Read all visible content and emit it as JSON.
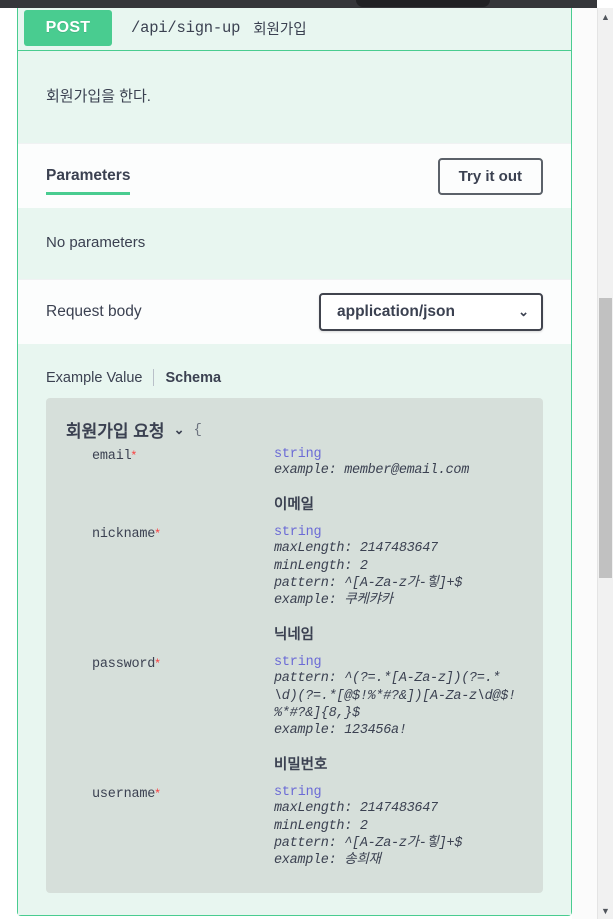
{
  "browser": {
    "chrome_bar": "",
    "scrollbar": {
      "up_arrow": "▲",
      "down_arrow": "▼"
    }
  },
  "operation": {
    "method": "POST",
    "path": "/api/sign-up",
    "summary": "회원가입",
    "description": "회원가입을 한다.",
    "method_color": "#49cc90",
    "block_bg": "#e8f6f0"
  },
  "parameters_section": {
    "title": "Parameters",
    "try_it_out_label": "Try it out",
    "empty_text": "No parameters"
  },
  "request_body_section": {
    "title": "Request body",
    "content_type": "application/json",
    "chevron": "⌄",
    "tabs": {
      "example_value": "Example Value",
      "schema": "Schema"
    }
  },
  "model": {
    "title": "회원가입 요청",
    "toggle": "⌄",
    "open_brace": "{",
    "properties": [
      {
        "name": "email",
        "required_marker": "*",
        "type": "string",
        "constraints": "example: member@email.com",
        "description": "이메일"
      },
      {
        "name": "nickname",
        "required_marker": "*",
        "type": "string",
        "constraints": "maxLength: 2147483647\nminLength: 2\npattern: ^[A-Za-z가-힣]+$\nexample: 쿠케캬카",
        "description": "닉네임"
      },
      {
        "name": "password",
        "required_marker": "*",
        "type": "string",
        "constraints": "pattern: ^(?=.*[A-Za-z])(?=.*\\d)(?=.*[@$!%*#?&])[A-Za-z\\d@$!%*#?&]{8,}$\nexample: 123456a!",
        "description": "비밀번호"
      },
      {
        "name": "username",
        "required_marker": "*",
        "type": "string",
        "constraints": "maxLength: 2147483647\nminLength: 2\npattern: ^[A-Za-z가-힣]+$\nexample: 송희재",
        "description": ""
      }
    ]
  }
}
